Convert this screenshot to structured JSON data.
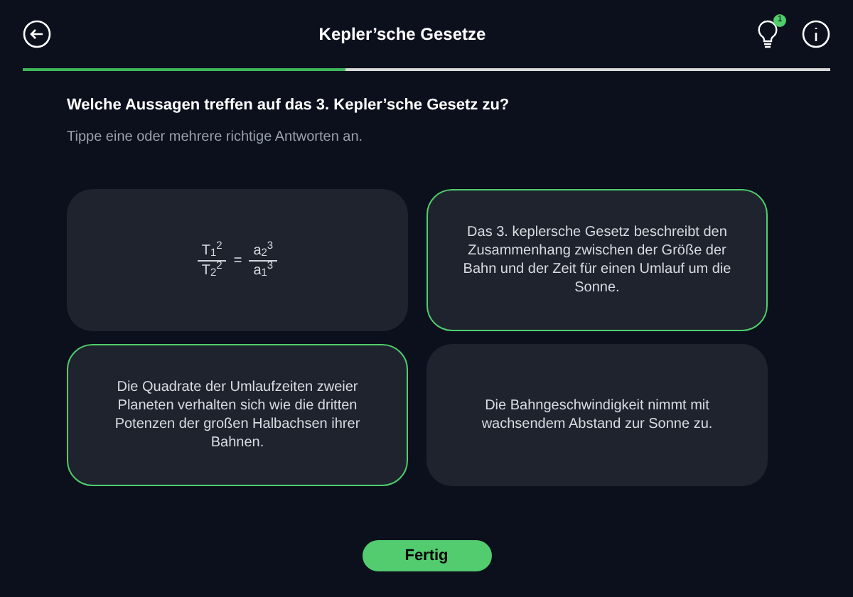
{
  "header": {
    "title": "Kepler’sche Gesetze",
    "hint_badge": "1",
    "progress": {
      "level": 0.4
    }
  },
  "question": "Welche Aussagen treffen auf das 3. Kepler’sche Gesetz zu?",
  "instruction": "Tippe eine oder mehrere richtige Antworten an.",
  "answers": [
    {
      "kind": "formula",
      "selected": false,
      "left": {
        "numerator": "T$_{1}$$^{2}$",
        "denominator": "T$_{2}$$^{2}$"
      },
      "equals": "=",
      "right": {
        "numerator": "a$_{2}$$^{3}$",
        "denominator": "a$_{1}$$^{3}$"
      }
    },
    {
      "kind": "text",
      "selected": true,
      "text": "Das 3. keplersche Gesetz beschreibt den Zusammenhang zwischen der Größe der Bahn und der Zeit für einen Umlauf um die Sonne."
    },
    {
      "kind": "text",
      "selected": true,
      "text": "Die Quadrate der Umlaufzeiten zweier Planeten verhalten sich wie die dritten Potenzen der großen Halbachsen ihrer Bahnen."
    },
    {
      "kind": "text",
      "selected": false,
      "text": "Die Bahngeschwindigkeit nimmt mit wachsendem Abstand zur Sonne zu."
    }
  ],
  "submit": "Fertig"
}
